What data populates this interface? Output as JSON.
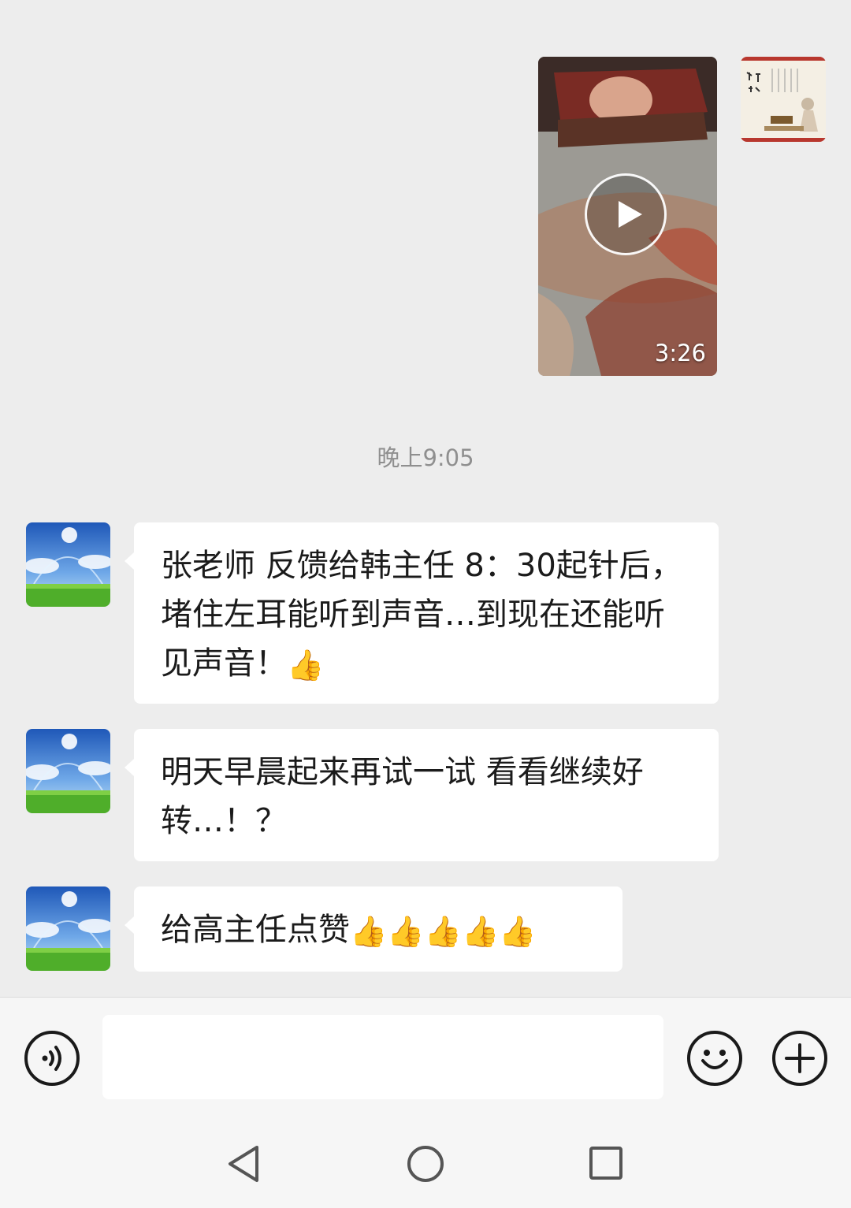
{
  "chat": {
    "video_message": {
      "duration": "3:26",
      "play_icon": "play-icon"
    },
    "timestamp": "晚上9:05",
    "messages": [
      {
        "text": "张老师 反馈给韩主任 8：30起针后，堵住左耳能听到声音…到现在还能听见声音！",
        "emoji": "👍"
      },
      {
        "text": "明天早晨起来再试一试 看看继续好转…！？"
      },
      {
        "text": "给高主任点赞",
        "emoji": "👍👍👍👍👍"
      }
    ]
  },
  "input_bar": {
    "voice_icon": "voice-icon",
    "text_value": "",
    "emoji_icon": "smiley-icon",
    "more_icon": "plus-icon"
  },
  "nav_bar": {
    "back_icon": "back-triangle-icon",
    "home_icon": "home-circle-icon",
    "recents_icon": "recents-square-icon"
  },
  "colors": {
    "background": "#ededed",
    "bubble": "#ffffff",
    "timestamp": "#8f8f8f"
  }
}
